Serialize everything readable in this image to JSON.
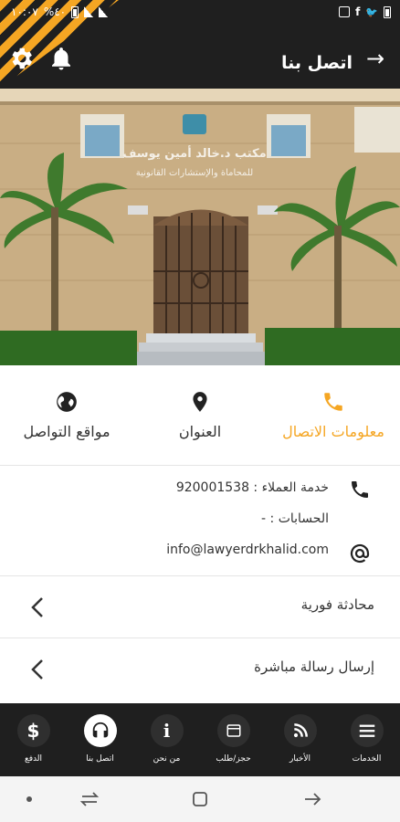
{
  "status_bar": {
    "time": "١٠:٠٧",
    "battery": "%٤٠"
  },
  "header": {
    "title": "اتصل بنا"
  },
  "hero": {
    "sign_line1": "مكتب د.خالد أمين يوسف",
    "sign_line2": "للمحاماة والإستشارات القانونية"
  },
  "tabs": [
    {
      "label": "معلومات الاتصال",
      "icon": "phone-icon",
      "active": true
    },
    {
      "label": "العنوان",
      "icon": "location-pin-icon",
      "active": false
    },
    {
      "label": "مواقع التواصل",
      "icon": "globe-icon",
      "active": false
    }
  ],
  "contact": {
    "customer_service": "خدمة العملاء : 920001538",
    "accounts": "الحسابات : -",
    "email": "info@lawyerdrkhalid.com"
  },
  "rows": {
    "live_chat": "محادثة فورية",
    "direct_message": "إرسال رسالة مباشرة"
  },
  "bottom_nav": [
    {
      "label": "الخدمات",
      "icon": "menu-icon"
    },
    {
      "label": "الأخبار",
      "icon": "rss-icon"
    },
    {
      "label": "حجز/طلب",
      "icon": "booking-icon"
    },
    {
      "label": "من نحن",
      "icon": "info-icon"
    },
    {
      "label": "اتصل بنا",
      "icon": "headset-icon",
      "active": true
    },
    {
      "label": "الدفع",
      "icon": "dollar-icon"
    }
  ],
  "colors": {
    "accent": "#f5a623",
    "dark": "#1f1f1f"
  }
}
